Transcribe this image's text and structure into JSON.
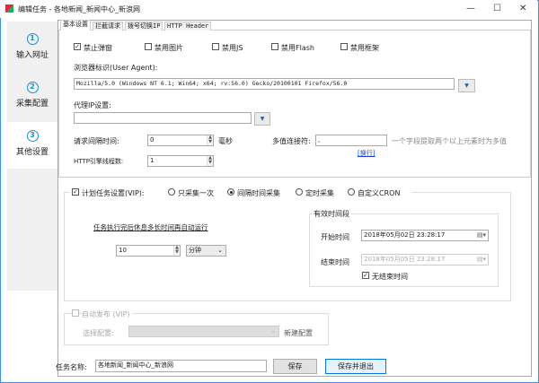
{
  "window": {
    "title": "编辑任务 - 各地新闻_新闻中心_新浪网",
    "minimize": "—",
    "maximize": "☐",
    "close": "✕"
  },
  "nav": [
    {
      "num": "1",
      "label": "输入网址"
    },
    {
      "num": "2",
      "label": "采集配置"
    },
    {
      "num": "3",
      "label": "其他设置",
      "selected": true
    }
  ],
  "tabs": [
    "基本设置",
    "拦截请求",
    "拨号切换IP",
    "HTTP Header"
  ],
  "basic": {
    "checkboxes": [
      {
        "label": "禁止弹窗",
        "checked": true
      },
      {
        "label": "禁用图片",
        "checked": false
      },
      {
        "label": "禁用JS",
        "checked": false
      },
      {
        "label": "禁用Flash",
        "checked": false
      },
      {
        "label": "禁用框架",
        "checked": false
      }
    ],
    "ua_label": "浏览器标识(User Agent):",
    "ua_value": "Mozilla/5.0 (Windows NT 6.1; Win64; x64; rv:56.0) Gecko/20100101 Firefox/56.0",
    "proxy_label": "代理IP设置:",
    "proxy_value": "",
    "interval_label": "请求间隔时间:",
    "interval_value": "0",
    "interval_unit": "毫秒",
    "joiner_label": "多值连接符:",
    "joiner_value": ",",
    "joiner_hint": "一个字段提取两个以上元素时为多值",
    "newline_link": "[换行]",
    "threads_label": "HTTP引擎线程数:",
    "threads_value": "1"
  },
  "schedule": {
    "label": "计划任务设置(VIP):",
    "checked": true,
    "modes": [
      {
        "label": "只采集一次",
        "selected": false
      },
      {
        "label": "间隔时间采集",
        "selected": true
      },
      {
        "label": "定时采集",
        "selected": false
      },
      {
        "label": "自定义CRON",
        "selected": false
      }
    ],
    "rest_text": "任务执行完后休息多长时间再自动运行",
    "rest_value": "10",
    "rest_unit": "分钟",
    "period_title": "有效时间段",
    "start_label": "开始时间",
    "start_value": "2018年05月02日 23:28:17",
    "end_label": "结束时间",
    "end_value": "2018年05月05日 23:28:17",
    "no_end_label": "无结束时间",
    "no_end_checked": true
  },
  "publish": {
    "label": "自动发布 (VIP)",
    "checked": false,
    "config_label": "选择配置:",
    "config_value": "",
    "new_config": "新建配置"
  },
  "footer": {
    "name_label": "任务名称:",
    "name_value": "各地新闻_新闻中心_新浪网",
    "save": "保存",
    "save_exit": "保存并退出"
  }
}
